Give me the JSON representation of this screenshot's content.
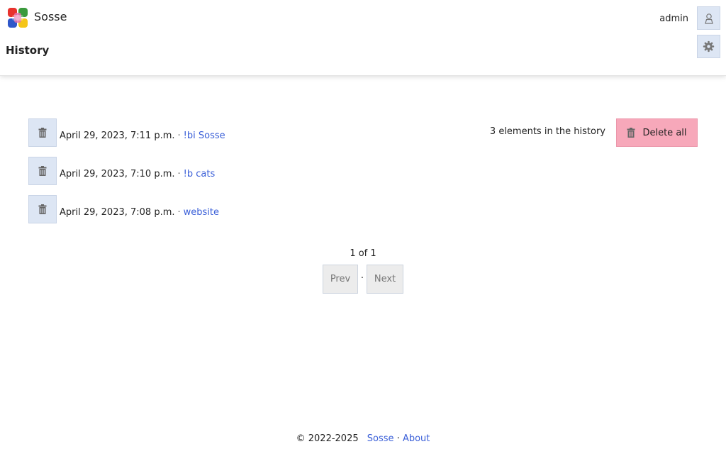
{
  "header": {
    "app_name": "Sosse",
    "page_title": "History",
    "username": "admin",
    "user_icon": "user-icon",
    "settings_icon": "gear-icon"
  },
  "history": {
    "count_text": "3 elements in the history",
    "delete_all_label": "Delete all",
    "delete_icon": "trash-icon",
    "entries": [
      {
        "date": "April 29, 2023, 7:11 p.m.",
        "separator": "·",
        "query": "!bi Sosse"
      },
      {
        "date": "April 29, 2023, 7:10 p.m.",
        "separator": "·",
        "query": "!b cats"
      },
      {
        "date": "April 29, 2023, 7:08 p.m.",
        "separator": "·",
        "query": "website"
      }
    ]
  },
  "pagination": {
    "info": "1 of 1",
    "prev_label": "Prev",
    "separator": "·",
    "next_label": "Next"
  },
  "footer": {
    "copyright": "© 2022-2025",
    "sosse_link": "Sosse",
    "separator": "·",
    "about_link": "About"
  },
  "colors": {
    "link": "#3a5fd8",
    "button_bg": "#dde6f4",
    "danger_bg": "#f7a8ba"
  }
}
